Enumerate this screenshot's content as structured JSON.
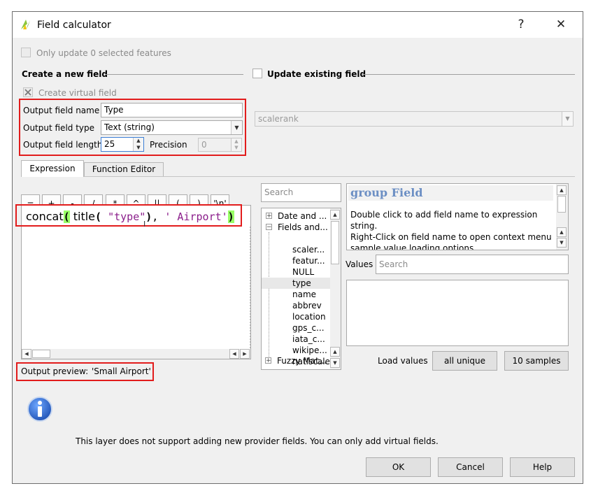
{
  "window": {
    "title": "Field calculator",
    "help_glyph": "?",
    "close_glyph": "✕"
  },
  "only_update_label": "Only update 0 selected features",
  "create_new_field": {
    "title": "Create a new field",
    "virtual_label": "Create virtual field",
    "output_name_label": "Output field name",
    "output_name_value": "Type",
    "output_type_label": "Output field type",
    "output_type_value": "Text (string)",
    "output_length_label": "Output field length",
    "output_length_value": "25",
    "precision_label": "Precision",
    "precision_value": "0"
  },
  "update_existing": {
    "title": "Update existing field",
    "field_value": "scalerank"
  },
  "tabs": [
    {
      "label": "Expression"
    },
    {
      "label": "Function Editor"
    }
  ],
  "operators": [
    "=",
    "+",
    "-",
    "/",
    "*",
    "^",
    "||",
    "(",
    ")",
    "'\\n'"
  ],
  "expression": {
    "part_func": "concat",
    "part_open1": "(",
    "part_title": " title",
    "part_open2": "( ",
    "part_field": "\"type\"",
    "part_close": ")",
    "part_comma": ",",
    "part_string": " ' Airport'",
    "part_close_final": ")"
  },
  "output_preview": {
    "label": "Output preview:",
    "value": "'Small Airport'"
  },
  "search_placeholder": "Search",
  "tree": {
    "groups": [
      "Date and ...",
      "Fields and...",
      "Fuzzy Mat..."
    ],
    "fields": [
      "scaler...",
      "featur...",
      "NULL",
      "type",
      "name",
      "abbrev",
      "location",
      "gps_c...",
      "iata_c...",
      "wikipe...",
      "natlscale"
    ]
  },
  "help": {
    "title": "group Field",
    "text1": "Double click to add field name to expression string.",
    "text2": "Right-Click on field name to open context menu sample value loading options."
  },
  "values": {
    "label": "Values",
    "search_placeholder": "Search",
    "load_label": "Load values",
    "all_unique": "all unique",
    "samples": "10 samples"
  },
  "info_text": "This layer does not support adding new provider fields. You can only add virtual fields.",
  "buttons": {
    "ok": "OK",
    "cancel": "Cancel",
    "help": "Help"
  },
  "colors": {
    "highlight_box": "#e21c1c",
    "bracket_highlight": "#99ff66",
    "string_color": "#8b1e8b",
    "help_title": "#6c8fc4"
  }
}
